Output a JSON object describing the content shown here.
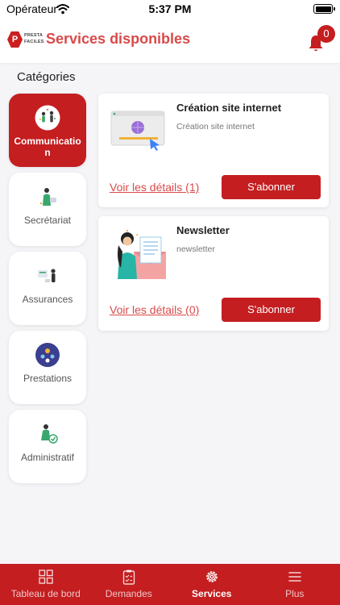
{
  "status_bar": {
    "carrier": "Opérateur",
    "time": "5:37 PM"
  },
  "header": {
    "logo_text": "PRESTA\nFACILES",
    "title": "Services disponibles",
    "notification_count": "0"
  },
  "categories_title": "Catégories",
  "categories": [
    {
      "label": "Communication",
      "active": true
    },
    {
      "label": "Secrétariat"
    },
    {
      "label": "Assurances"
    },
    {
      "label": "Prestations"
    },
    {
      "label": "Administratif"
    }
  ],
  "services": [
    {
      "title": "Création site internet",
      "subtitle": "Création site internet",
      "details_link": "Voir les détails (1)",
      "subscribe": "S'abonner"
    },
    {
      "title": "Newsletter",
      "subtitle": "newsletter",
      "details_link": "Voir les détails (0)",
      "subscribe": "S'abonner"
    }
  ],
  "tabbar": [
    {
      "label": "Tableau de bord",
      "icon": "dashboard-icon"
    },
    {
      "label": "Demandes",
      "icon": "clipboard-icon"
    },
    {
      "label": "Services",
      "icon": "gear-icon",
      "active": true
    },
    {
      "label": "Plus",
      "icon": "menu-icon"
    }
  ],
  "colors": {
    "primary": "#c41e20",
    "title_red": "#d94a4a",
    "background": "#f5f5f8"
  }
}
